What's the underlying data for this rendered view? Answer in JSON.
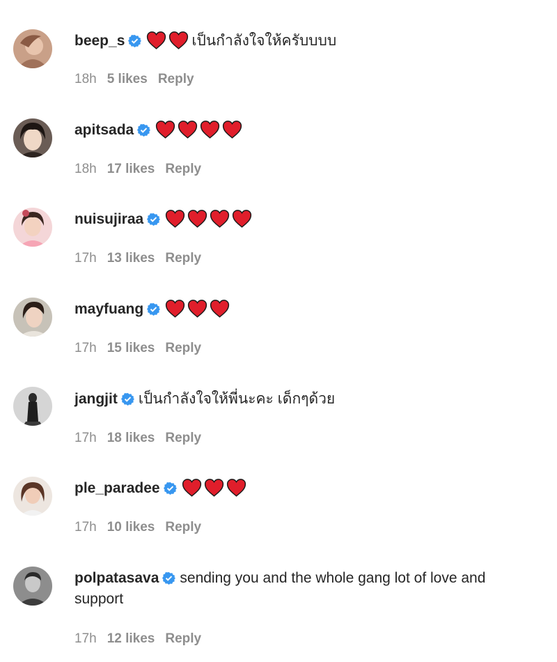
{
  "colors": {
    "verified": "#3897f0",
    "heart": "#e01e2b",
    "meta": "#8e8e8e",
    "text": "#262626"
  },
  "icons": {
    "verified": "verified-badge-icon",
    "heart": "red-heart-icon"
  },
  "comments": [
    {
      "username": "beep_s",
      "hearts": 2,
      "text": "เป็นกำลังใจให้ครับบบบ",
      "time": "18h",
      "likes": "5 likes",
      "reply": "Reply"
    },
    {
      "username": "apitsada",
      "hearts": 4,
      "text": "",
      "time": "18h",
      "likes": "17 likes",
      "reply": "Reply"
    },
    {
      "username": "nuisujiraa",
      "hearts": 4,
      "text": "",
      "time": "17h",
      "likes": "13 likes",
      "reply": "Reply"
    },
    {
      "username": "mayfuang",
      "hearts": 3,
      "text": "",
      "time": "17h",
      "likes": "15 likes",
      "reply": "Reply"
    },
    {
      "username": "jangjit",
      "hearts": 0,
      "text": "เป็นกำลังใจให้พี่นะคะ เด็กๆด้วย",
      "time": "17h",
      "likes": "18 likes",
      "reply": "Reply"
    },
    {
      "username": "ple_paradee",
      "hearts": 3,
      "text": "",
      "time": "17h",
      "likes": "10 likes",
      "reply": "Reply"
    },
    {
      "username": "polpatasava",
      "hearts": 0,
      "text": "sending you and the whole gang lot of love and support",
      "time": "17h",
      "likes": "12 likes",
      "reply": "Reply"
    }
  ]
}
